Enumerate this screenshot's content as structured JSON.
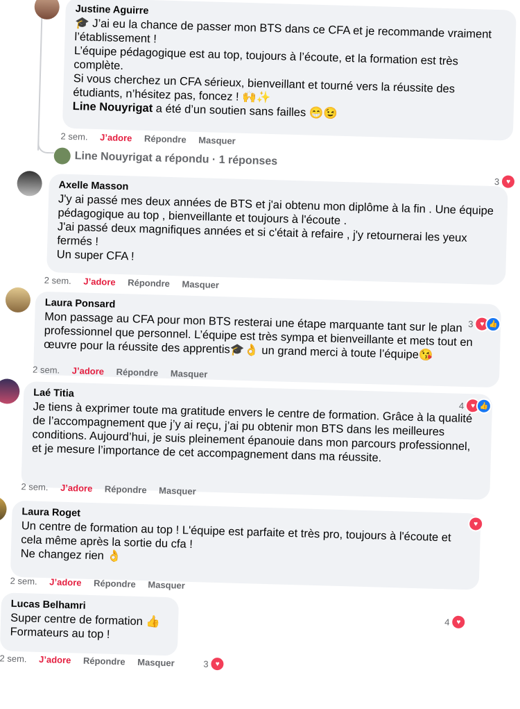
{
  "colors": {
    "bubble": "#f0f2f5",
    "love": "#e41e3f",
    "meta": "#65676b",
    "heart": "#f33e58",
    "like": "#1877f2"
  },
  "action_labels": {
    "time": "2 sem.",
    "love": "J’adore",
    "reply": "Répondre",
    "hide": "Masquer"
  },
  "comments": [
    {
      "author": "Justine Aguirre",
      "text_1": "🎓 J’ai eu la chance de passer mon BTS dans ce CFA et je recommande vraiment l’établissement !\nL’équipe pédagogique est au top, toujours à l’écoute, et la formation est très complète.\nSi vous cherchez un CFA sérieux, bienveillant et tourné vers la réussite des étudiants, n’hésitez pas, foncez ! 🙌✨",
      "mention": "Line Nouyrigat",
      "text_2": " a été d’un soutien sans failles 😁😉",
      "reaction_count": "3"
    },
    {
      "author": "Axelle Masson",
      "text": "J'y ai passé mes deux années de BTS et j'ai obtenu mon diplôme à la fin . Une équipe pédagogique au top , bienveillante et toujours à l'écoute .\nJ'ai passé deux magnifiques années et si c'était à refaire , j'y retournerai les yeux fermés !\nUn super CFA !",
      "reaction_count": ""
    },
    {
      "author": "Laura Ponsard",
      "text": "Mon passage au CFA pour mon BTS resterai une étape marquante tant sur le plan professionnel que personnel. L’équipe est très sympa et bienveillante et mets tout en œuvre pour la réussite des apprentis🎓👌 un grand merci à toute l’équipe😘",
      "reaction_count": "3"
    },
    {
      "author": "Laé Titia",
      "text": "Je tiens à exprimer toute ma gratitude envers le centre de formation. Grâce à la qualité de l’accompagnement que j’y ai reçu, j’ai pu obtenir mon BTS dans les meilleures conditions. Aujourd’hui, je suis pleinement épanouie dans mon parcours professionnel, et je mesure l’importance de cet accompagnement dans ma réussite.",
      "reaction_count": "4"
    },
    {
      "author": "Laura Roget",
      "text": "Un centre de formation au top ! L'équipe est parfaite et très pro, toujours à l'écoute et cela même après la sortie du cfa !\nNe changez rien 👌",
      "reaction_count": ""
    },
    {
      "author": "Lucas Belhamri",
      "text": "Super centre de formation 👍\nFormateurs au top !",
      "reaction_count": "4"
    }
  ],
  "reply_summary": "Line Nouyrigat a répondu · 1 réponses",
  "bottom_reaction_count": "3"
}
